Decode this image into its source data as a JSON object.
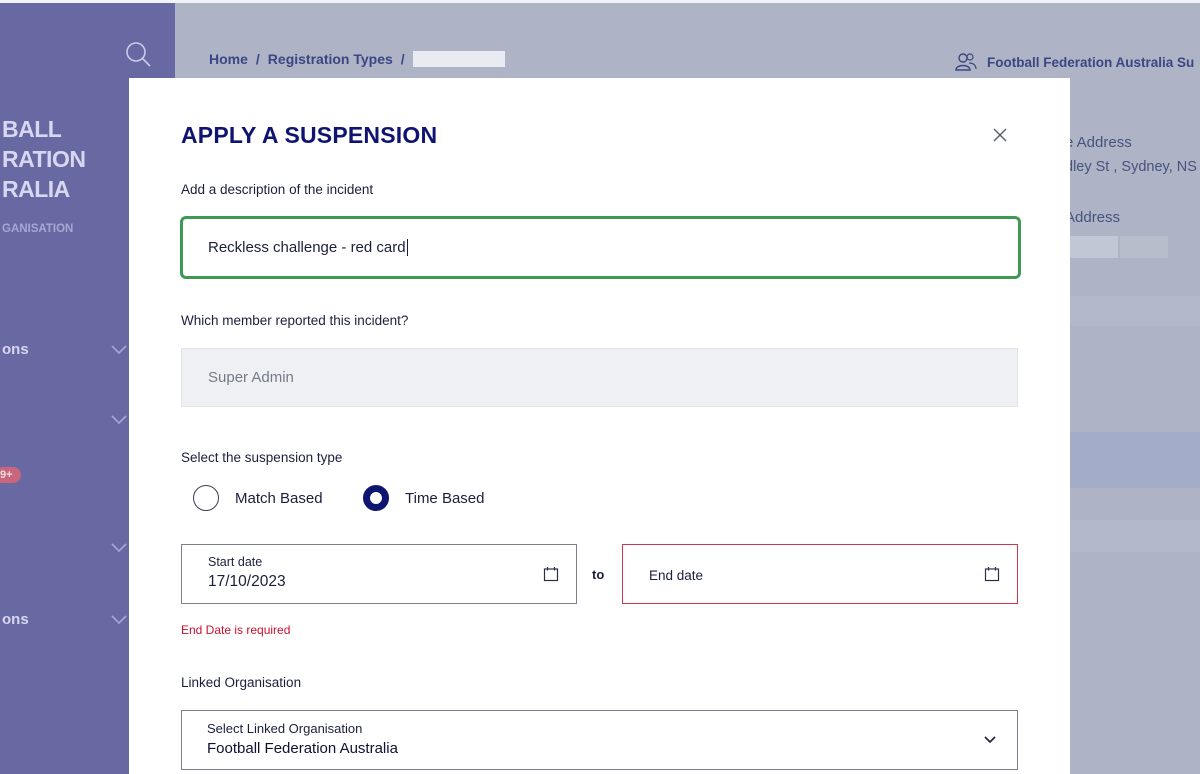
{
  "breadcrumb": {
    "home": "Home",
    "sep": "/",
    "registration_types": "Registration Types"
  },
  "header": {
    "organisation": "Football Federation Australia Su"
  },
  "sidebar": {
    "brand_lines": [
      "BALL",
      "RATION",
      "RALIA"
    ],
    "brand_sub": "GANISATION",
    "items": [
      {
        "label": "ons"
      },
      {
        "label": ""
      },
      {
        "label": ""
      },
      {
        "label": "ons"
      }
    ],
    "badge": "9+"
  },
  "background_details": {
    "address_label": "e Address",
    "address_value": "dley St , Sydney, NS",
    "address2_label": "Address"
  },
  "modal": {
    "title": "APPLY A SUSPENSION",
    "description_label": "Add a description of the incident",
    "description_value": "Reckless challenge - red card",
    "member_label": "Which member reported this incident?",
    "member_value": "Super Admin",
    "suspension_type_label": "Select the suspension type",
    "suspension_types": [
      {
        "label": "Match Based",
        "selected": false
      },
      {
        "label": "Time Based",
        "selected": true
      }
    ],
    "start_date_label": "Start date",
    "start_date_value": "17/10/2023",
    "to_label": "to",
    "end_date_placeholder": "End date",
    "end_date_error": "End Date is required",
    "linked_org_label": "Linked Organisation",
    "linked_org_select_label": "Select Linked Organisation",
    "linked_org_value": "Football Federation Australia"
  },
  "colors": {
    "primary": "#0e1470",
    "focus_border": "#3d9a54",
    "error": "#c9102e",
    "overlay": "#aeb4c6",
    "sidebar": "#6869a3"
  },
  "icons": [
    "search-icon",
    "chevron-down-icon",
    "user-group-icon",
    "close-icon",
    "calendar-icon"
  ]
}
